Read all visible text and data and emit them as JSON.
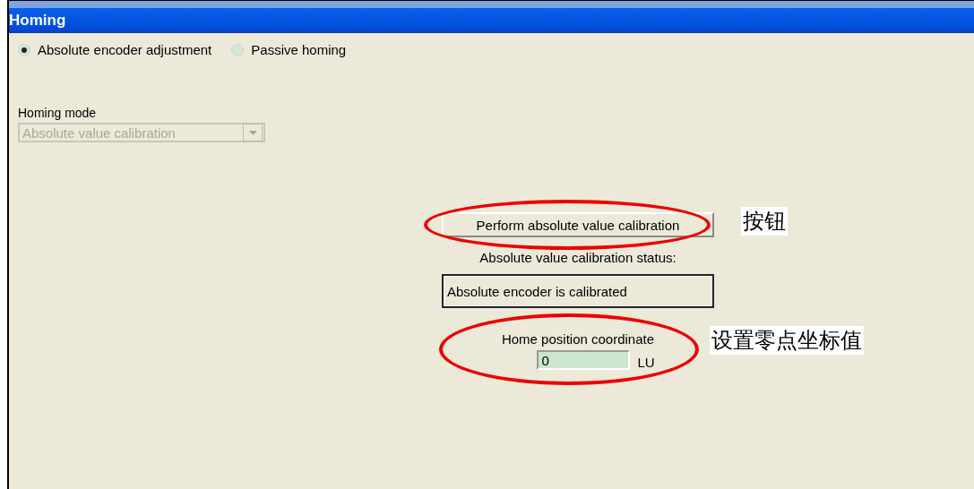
{
  "window": {
    "title": "Homing"
  },
  "radios": [
    {
      "label": "Absolute encoder adjustment",
      "selected": true
    },
    {
      "label": "Passive homing",
      "selected": false
    }
  ],
  "homing_mode": {
    "label": "Homing mode",
    "value": "Absolute value calibration",
    "disabled": true
  },
  "calibrate_button": {
    "label": "Perform absolute value calibration"
  },
  "status": {
    "label": "Absolute value calibration status:",
    "value": "Absolute encoder is calibrated"
  },
  "home_position": {
    "label": "Home position coordinate",
    "value": "0",
    "unit": "LU"
  },
  "annotations": [
    {
      "text": "按钮"
    },
    {
      "text": "设置零点坐标值"
    }
  ]
}
